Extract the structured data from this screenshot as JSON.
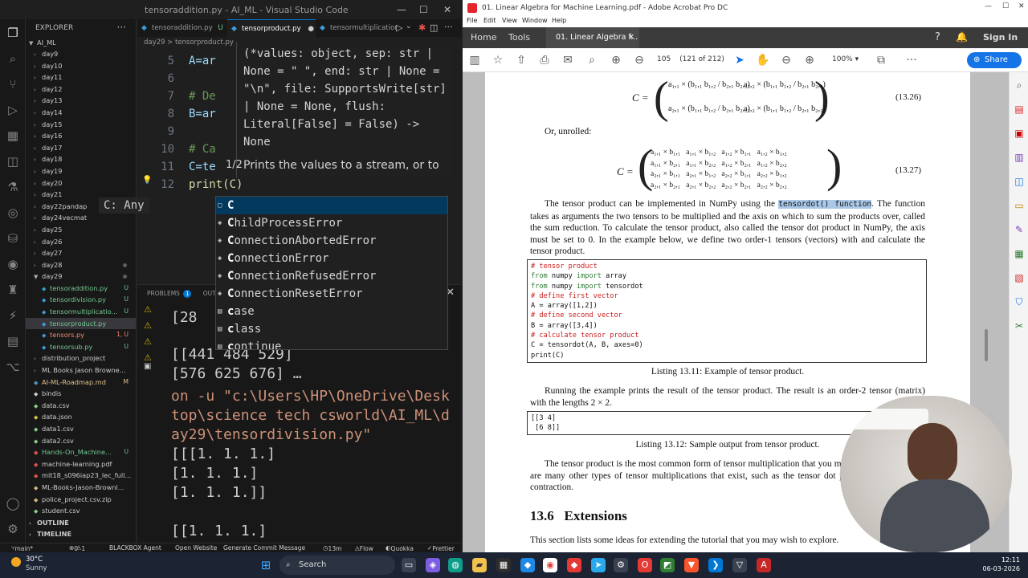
{
  "vscode": {
    "title": "tensoraddition.py - AI_ML - Visual Studio Code",
    "explorer_title": "EXPLORER",
    "root_folder": "AI_ML",
    "tree": [
      {
        "label": "day9",
        "type": "folder",
        "state": "collapsed"
      },
      {
        "label": "day10",
        "type": "folder",
        "state": "collapsed"
      },
      {
        "label": "day11",
        "type": "folder",
        "state": "collapsed"
      },
      {
        "label": "day12",
        "type": "folder",
        "state": "collapsed"
      },
      {
        "label": "day13",
        "type": "folder",
        "state": "collapsed"
      },
      {
        "label": "day14",
        "type": "folder",
        "state": "collapsed"
      },
      {
        "label": "day15",
        "type": "folder",
        "state": "collapsed"
      },
      {
        "label": "day16",
        "type": "folder",
        "state": "collapsed"
      },
      {
        "label": "day17",
        "type": "folder",
        "state": "collapsed"
      },
      {
        "label": "day18",
        "type": "folder",
        "state": "collapsed"
      },
      {
        "label": "day19",
        "type": "folder",
        "state": "collapsed"
      },
      {
        "label": "day20",
        "type": "folder",
        "state": "collapsed"
      },
      {
        "label": "day21",
        "type": "folder",
        "state": "collapsed"
      },
      {
        "label": "day22pandap",
        "type": "folder",
        "state": "collapsed"
      },
      {
        "label": "day24vecmat",
        "type": "folder",
        "state": "collapsed"
      },
      {
        "label": "day25",
        "type": "folder",
        "state": "collapsed"
      },
      {
        "label": "day26",
        "type": "folder",
        "state": "collapsed"
      },
      {
        "label": "day27",
        "type": "folder",
        "state": "collapsed"
      },
      {
        "label": "day28",
        "type": "folder",
        "state": "collapsed",
        "dot": true
      },
      {
        "label": "day29",
        "type": "folder",
        "state": "expanded",
        "dot": true
      },
      {
        "label": "tensoraddition.py",
        "type": "py",
        "badge": "U",
        "child": true
      },
      {
        "label": "tensordivision.py",
        "type": "py",
        "badge": "U",
        "child": true
      },
      {
        "label": "tensormultiplicatio...",
        "type": "py",
        "badge": "U",
        "child": true
      },
      {
        "label": "tensorproduct.py",
        "type": "py",
        "badge": "",
        "child": true,
        "selected": true
      },
      {
        "label": "tensors.py",
        "type": "py",
        "badge": "1, U",
        "child": true,
        "error": true
      },
      {
        "label": "tensorsub.py",
        "type": "py",
        "badge": "U",
        "child": true
      },
      {
        "label": "distribution_project",
        "type": "folder",
        "state": "collapsed"
      },
      {
        "label": "ML Books Jason Browne...",
        "type": "folder",
        "state": "collapsed"
      },
      {
        "label": "AI-ML-Roadmap.md",
        "type": "md",
        "badge": "M"
      },
      {
        "label": "bindis",
        "type": "file",
        "badge": ""
      },
      {
        "label": "data.csv",
        "type": "csv",
        "badge": ""
      },
      {
        "label": "data.json",
        "type": "json",
        "badge": ""
      },
      {
        "label": "data1.csv",
        "type": "csv",
        "badge": ""
      },
      {
        "label": "data2.csv",
        "type": "csv",
        "badge": ""
      },
      {
        "label": "Hands-On_Machine...",
        "type": "pdf",
        "badge": "U"
      },
      {
        "label": "machine-learning.pdf",
        "type": "pdf",
        "badge": ""
      },
      {
        "label": "mit18_s096iap23_lec_full...",
        "type": "pdf",
        "badge": ""
      },
      {
        "label": "ML-Books-Jason-Brownl...",
        "type": "zip",
        "badge": ""
      },
      {
        "label": "police_project.csv.zip",
        "type": "zip",
        "badge": ""
      },
      {
        "label": "student.csv",
        "type": "csv",
        "badge": ""
      }
    ],
    "outline_label": "OUTLINE",
    "timeline_label": "TIMELINE",
    "tabs": [
      {
        "label": "tensoraddition.py",
        "badge": "U",
        "active": false
      },
      {
        "label": "tensorproduct.py",
        "badge": "●",
        "active": true
      },
      {
        "label": "tensormultiplicatior",
        "badge": "",
        "active": false
      }
    ],
    "breadcrumb": "day29 > tensorproduct.py",
    "code_lines": [
      {
        "num": "5",
        "text": "A=ar"
      },
      {
        "num": "6",
        "text": ""
      },
      {
        "num": "7",
        "text": "# De"
      },
      {
        "num": "8",
        "text": "B=ar"
      },
      {
        "num": "9",
        "text": ""
      },
      {
        "num": "10",
        "text": "# Ca"
      },
      {
        "num": "11",
        "text": "C=te"
      },
      {
        "num": "12",
        "text": "print(C)"
      }
    ],
    "hover_signature": "(*values: object, sep: str | None = \" \", end: str | None = \"\\n\", file: SupportsWrite[str] | None = None, flush: Literal[False] = False) -> None",
    "hover_page": "1/2",
    "hover_doc": "Prints the values to a stream, or to",
    "inline_hint": "C: Any",
    "suggestions": [
      {
        "label": "C",
        "kind": "var"
      },
      {
        "label": "ChildProcessError",
        "kind": "class"
      },
      {
        "label": "ConnectionAbortedError",
        "kind": "class"
      },
      {
        "label": "ConnectionError",
        "kind": "class"
      },
      {
        "label": "ConnectionRefusedError",
        "kind": "class"
      },
      {
        "label": "ConnectionResetError",
        "kind": "class"
      },
      {
        "label": "case",
        "kind": "kw"
      },
      {
        "label": "class",
        "kind": "kw"
      },
      {
        "label": "continue",
        "kind": "kw"
      }
    ],
    "panel_tabs": {
      "problems": "PROBLEMS",
      "problems_count": "1",
      "output": "OUTP"
    },
    "terminal_lines": [
      "[28",
      "[[441 484 529]",
      " [576 625 676] …",
      "on -u \"c:\\Users\\HP\\OneDrive\\Desk",
      "top\\science tech csworld\\AI_ML\\d",
      "ay29\\tensordivision.py\"",
      "[[[1. 1. 1.]",
      "  [1. 1. 1.]",
      "  [1. 1. 1.]]",
      "",
      " [[1. 1. 1.]"
    ],
    "status": {
      "branch": "main*",
      "errors": "0",
      "warnings": "1",
      "blackbox": "BLACKBOX Agent",
      "open_website": "Open Website",
      "generate_commit": "Generate Commit Message",
      "time": "13m",
      "flow": "Flow",
      "quokka": "Quokka",
      "prettier": "Prettier"
    }
  },
  "acrobat": {
    "title": "01. Linear Algebra for Machine Learning.pdf - Adobe Acrobat Pro DC",
    "menu": [
      "File",
      "Edit",
      "View",
      "Window",
      "Help"
    ],
    "nav": {
      "home": "Home",
      "tools": "Tools",
      "doc_tab": "01. Linear Algebra f...",
      "sign_in": "Sign In"
    },
    "page_num": "105",
    "page_total": "(121 of 212)",
    "zoom": "100%",
    "share": "Share",
    "doc": {
      "eq_13_26": "(13.26)",
      "or_unrolled": "Or, unrolled:",
      "eq_13_27": "(13.27)",
      "para1_before": "The tensor product can be implemented in NumPy using the ",
      "para1_highlight": "tensordot() function",
      "para1_after": ". The function takes as arguments the two tensors to be multiplied and the axis on which to sum the products over, called the sum reduction. To calculate the tensor product, also called the tensor dot product in NumPy, the axis must be set to 0. In the example below, we define two order-1 tensors (vectors) with and calculate the tensor product.",
      "listing_1311": [
        {
          "t": "# tensor product",
          "c": "cm"
        },
        {
          "t": "from numpy import array",
          "c": "code"
        },
        {
          "t": "from numpy import tensordot",
          "c": "code"
        },
        {
          "t": "# define first vector",
          "c": "cm"
        },
        {
          "t": "A = array([1,2])",
          "c": "code"
        },
        {
          "t": "# define second vector",
          "c": "cm"
        },
        {
          "t": "B = array([3,4])",
          "c": "code"
        },
        {
          "t": "# calculate tensor product",
          "c": "cm"
        },
        {
          "t": "C = tensordot(A, B, axes=0)",
          "c": "code"
        },
        {
          "t": "print(C)",
          "c": "code"
        }
      ],
      "caption_1311": "Listing 13.11: Example of tensor product.",
      "para2": "Running the example prints the result of the tensor product. The result is an order-2 tensor (matrix) with the lengths 2 × 2.",
      "listing_1312": "[[3 4]\n [6 8]]",
      "caption_1312": "Listing 13.12: Sample output from tensor product.",
      "para3": "The tensor product is the most common form of tensor multiplication that you may encounter, but there are many other types of tensor multiplications that exist, such as the tensor dot product and the tensor contraction.",
      "section_num": "13.6",
      "section_title": "Extensions",
      "para4": "This section lists some ideas for extending the tutorial that you may wish to explore."
    }
  },
  "taskbar": {
    "weather_temp": "30°C",
    "weather_desc": "Sunny",
    "search_label": "Search",
    "time": "12:11",
    "date": "06-03-2026"
  }
}
